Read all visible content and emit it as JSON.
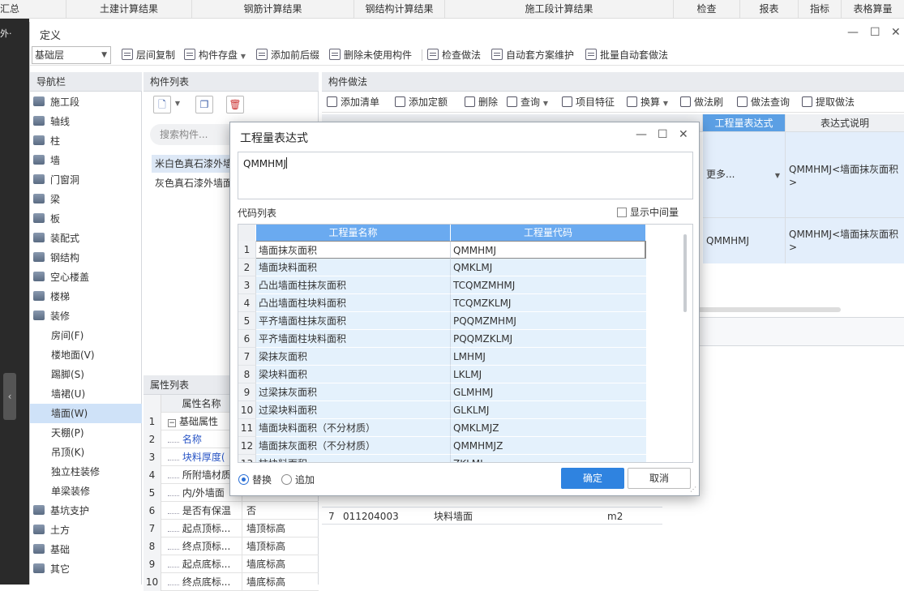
{
  "top_tabs": [
    "汇总",
    "土建计算结果",
    "钢筋计算结果",
    "钢结构计算结果",
    "施工段计算结果",
    "检查",
    "报表",
    "指标",
    "表格算量"
  ],
  "left_strip_label": "外·",
  "window": {
    "title": "定义",
    "layer_select": "基础层",
    "toolbar": [
      "层间复制",
      "构件存盘",
      "添加前后缀",
      "删除未使用构件",
      "检查做法",
      "自动套方案维护",
      "批量自动套做法"
    ]
  },
  "nav": {
    "header": "导航栏",
    "items": [
      {
        "label": "施工段",
        "sub": false
      },
      {
        "label": "轴线",
        "sub": false
      },
      {
        "label": "柱",
        "sub": false
      },
      {
        "label": "墙",
        "sub": false
      },
      {
        "label": "门窗洞",
        "sub": false
      },
      {
        "label": "梁",
        "sub": false
      },
      {
        "label": "板",
        "sub": false
      },
      {
        "label": "装配式",
        "sub": false
      },
      {
        "label": "钢结构",
        "sub": false
      },
      {
        "label": "空心楼盖",
        "sub": false
      },
      {
        "label": "楼梯",
        "sub": false
      },
      {
        "label": "装修",
        "sub": false
      },
      {
        "label": "房间(F)",
        "sub": true
      },
      {
        "label": "楼地面(V)",
        "sub": true
      },
      {
        "label": "踢脚(S)",
        "sub": true
      },
      {
        "label": "墙裙(U)",
        "sub": true
      },
      {
        "label": "墙面(W)",
        "sub": true,
        "selected": true
      },
      {
        "label": "天棚(P)",
        "sub": true
      },
      {
        "label": "吊顶(K)",
        "sub": true
      },
      {
        "label": "独立柱装修",
        "sub": true
      },
      {
        "label": "单梁装修",
        "sub": true
      },
      {
        "label": "基坑支护",
        "sub": false
      },
      {
        "label": "土方",
        "sub": false
      },
      {
        "label": "基础",
        "sub": false
      },
      {
        "label": "其它",
        "sub": false
      }
    ]
  },
  "component_list": {
    "header": "构件列表",
    "search_placeholder": "搜索构件...",
    "items": [
      "米白色真石漆外墙",
      "灰色真石漆外墙面"
    ]
  },
  "property_list": {
    "header": "属性列表",
    "col_name": "属性名称",
    "rows": [
      {
        "n": "1",
        "k": "基础属性",
        "v": "",
        "group": true
      },
      {
        "n": "2",
        "k": "名称",
        "v": "",
        "blue": true
      },
      {
        "n": "3",
        "k": "块料厚度(",
        "v": "",
        "blue": true
      },
      {
        "n": "4",
        "k": "所附墙材质",
        "v": ""
      },
      {
        "n": "5",
        "k": "内/外墙面",
        "v": ""
      },
      {
        "n": "6",
        "k": "是否有保温",
        "v": "否"
      },
      {
        "n": "7",
        "k": "起点顶标...",
        "v": "墙顶标高"
      },
      {
        "n": "8",
        "k": "终点顶标...",
        "v": "墙顶标高"
      },
      {
        "n": "9",
        "k": "起点底标...",
        "v": "墙底标高"
      },
      {
        "n": "10",
        "k": "终点底标...",
        "v": "墙底标高"
      }
    ]
  },
  "method_panel": {
    "header": "构件做法",
    "toolbar": [
      "添加清单",
      "添加定额",
      "删除",
      "查询",
      "项目特征",
      "换算",
      "做法刷",
      "做法查询",
      "提取做法"
    ],
    "col_expr": "工程量表达式",
    "col_desc": "表达式说明",
    "row1_expr": "更多...",
    "row1_desc": "QMMHMJ<墙面抹灰面积>",
    "row2_expr": "QMMHMJ",
    "row2_desc": "QMMHMJ<墙面抹灰面积>",
    "row7": {
      "n": "7",
      "code": "011204003",
      "name": "块料墙面",
      "unit": "m2"
    }
  },
  "dialog": {
    "title": "工程量表达式",
    "expression": "QMMHMJ",
    "code_list_label": "代码列表",
    "show_intermediate": "显示中间量",
    "col_name": "工程量名称",
    "col_code": "工程量代码",
    "rows": [
      {
        "n": "1",
        "name": "墙面抹灰面积",
        "code": "QMMHMJ"
      },
      {
        "n": "2",
        "name": "墙面块料面积",
        "code": "QMKLMJ"
      },
      {
        "n": "3",
        "name": "凸出墙面柱抹灰面积",
        "code": "TCQMZMHMJ"
      },
      {
        "n": "4",
        "name": "凸出墙面柱块料面积",
        "code": "TCQMZKLMJ"
      },
      {
        "n": "5",
        "name": "平齐墙面柱抹灰面积",
        "code": "PQQMZMHMJ"
      },
      {
        "n": "6",
        "name": "平齐墙面柱块料面积",
        "code": "PQQMZKLMJ"
      },
      {
        "n": "7",
        "name": "梁抹灰面积",
        "code": "LMHMJ"
      },
      {
        "n": "8",
        "name": "梁块料面积",
        "code": "LKLMJ"
      },
      {
        "n": "9",
        "name": "过梁抹灰面积",
        "code": "GLMHMJ"
      },
      {
        "n": "10",
        "name": "过梁块料面积",
        "code": "GLKLMJ"
      },
      {
        "n": "11",
        "name": "墙面块料面积（不分材质）",
        "code": "QMKLMJZ"
      },
      {
        "n": "12",
        "name": "墙面抹灰面积（不分材质）",
        "code": "QMMHMJZ"
      },
      {
        "n": "13",
        "name": "柱块料面积",
        "code": "ZKLMJ"
      }
    ],
    "radio_replace": "替换",
    "radio_append": "追加",
    "ok": "确定",
    "cancel": "取消"
  }
}
